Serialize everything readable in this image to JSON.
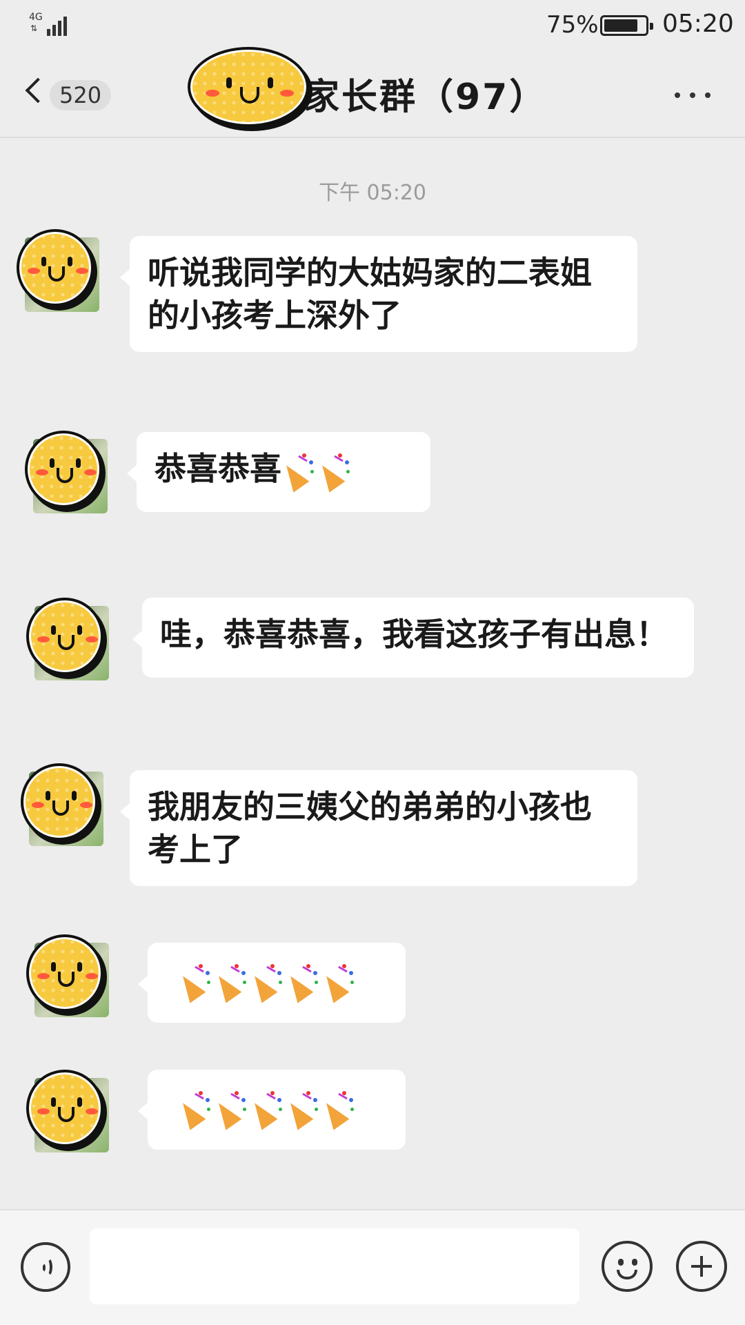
{
  "status_bar": {
    "network": "4G",
    "battery": "75%",
    "time": "05:20"
  },
  "header": {
    "back_count": "520",
    "title": "家长群（97）"
  },
  "chat": {
    "timestamp": "下午 05:20",
    "messages": [
      {
        "text": "听说我同学的大姑妈家的二表姐的小孩考上深外了"
      },
      {
        "text": "恭喜恭喜",
        "emoji": "🎉🎉"
      },
      {
        "text": "哇，恭喜恭喜，我看这孩子有出息！"
      },
      {
        "text": "我朋友的三姨父的弟弟的小孩也考上了"
      },
      {
        "text": "",
        "emoji": "🎉🎉🎉🎉🎉"
      },
      {
        "text": "",
        "emoji": "🎉🎉🎉🎉🎉"
      }
    ]
  },
  "input": {
    "value": "",
    "placeholder": ""
  },
  "icons": {
    "back": "chevron-left-icon",
    "more": "more-dots-icon",
    "voice": "voice-icon",
    "emoji": "emoji-icon",
    "plus": "plus-icon",
    "party": "party-popper-icon"
  },
  "colors": {
    "background": "#ededed",
    "bubble": "#ffffff",
    "sticker": "#f7c93e"
  }
}
